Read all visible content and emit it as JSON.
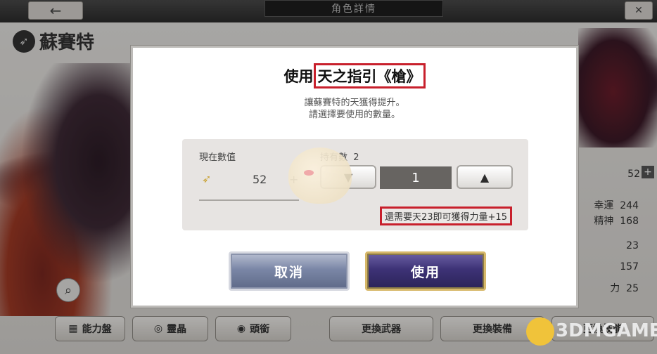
{
  "header": {
    "back_icon": "arrow-left-icon",
    "title": "角色詳情",
    "close_icon": "close-icon"
  },
  "character": {
    "name": "蘇賽特"
  },
  "stats": {
    "value_top": "52",
    "rows": [
      {
        "label": "幸運",
        "value": "244"
      },
      {
        "label": "精神",
        "value": "168"
      },
      {
        "label": "",
        "value": "23"
      },
      {
        "label": "",
        "value": "157"
      },
      {
        "label": "力",
        "value": "25"
      }
    ]
  },
  "bottom_tabs": {
    "ability_board": "能力盤",
    "spirit_crystal": "靈晶",
    "badge": "頭銜",
    "change_weapon": "更換武器",
    "change_equipment": "更換裝備",
    "change_skill": "更換技能"
  },
  "modal": {
    "title_prefix": "使用",
    "title_item": "天之指引《槍》",
    "desc_line1": "讓蘇賽特的天獲得提升。",
    "desc_line2": "請選擇要使用的數量。",
    "current_label": "現在數值",
    "current_value": "52",
    "plus": "+",
    "owned_label": "持有數",
    "owned_value": "2",
    "quantity": "1",
    "need_text": "還需要天23即可獲得力量+15",
    "cancel_label": "取消",
    "use_label": "使用"
  },
  "colors": {
    "highlight": "#c8202c",
    "use_button": "#3d3276",
    "cancel_button": "#7a86a6"
  },
  "watermark": {
    "text": "3DMGAME"
  }
}
